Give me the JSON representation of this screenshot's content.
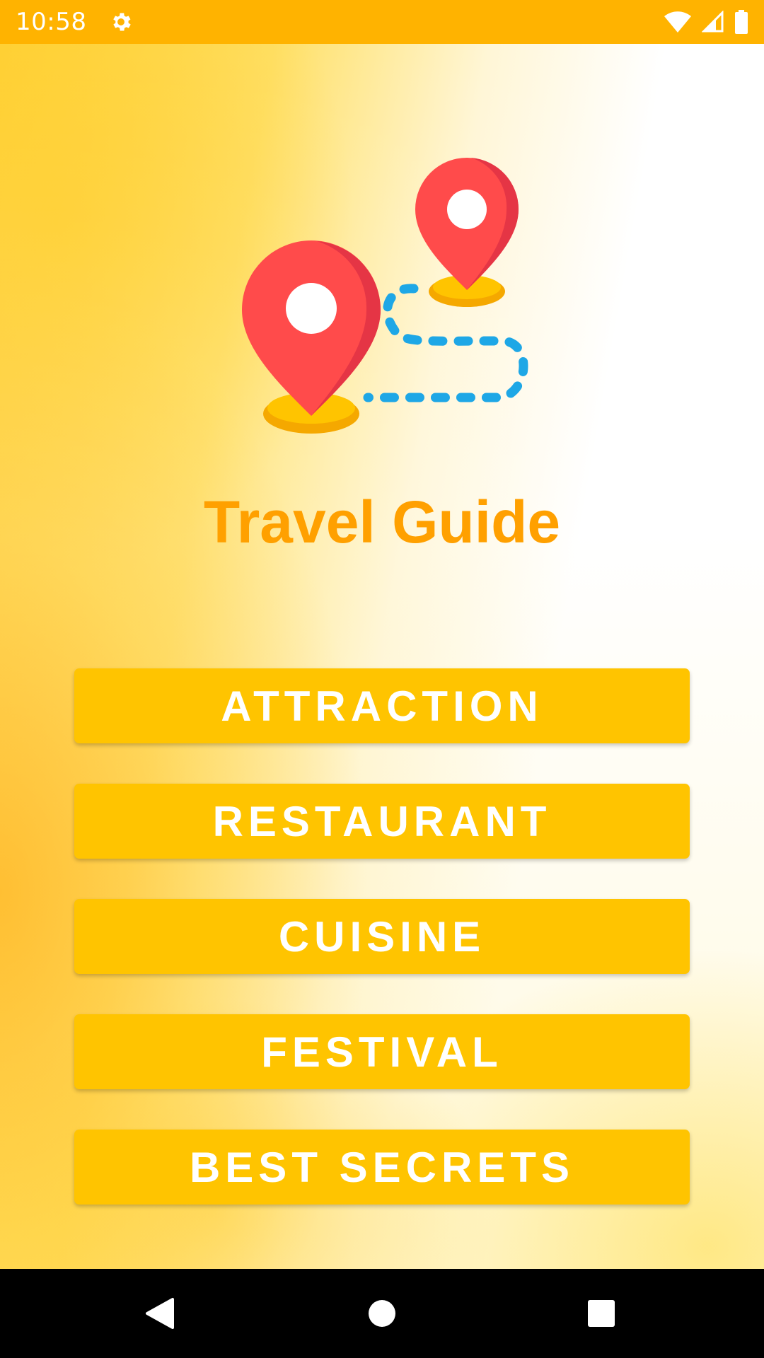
{
  "status_bar": {
    "time": "10:58",
    "icons": [
      "gear-icon",
      "wifi-icon",
      "signal-icon",
      "battery-icon"
    ]
  },
  "app": {
    "title": "Travel Guide",
    "logo_icon": "map-route-pins-icon"
  },
  "menu": {
    "items": [
      {
        "label": "ATTRACTION"
      },
      {
        "label": "RESTAURANT"
      },
      {
        "label": "CUISINE"
      },
      {
        "label": "FESTIVAL"
      },
      {
        "label": "BEST SECRETS"
      }
    ]
  },
  "nav_bar": {
    "icons": [
      "back-icon",
      "home-icon",
      "recents-icon"
    ]
  },
  "colors": {
    "status_bar": "#FFB300",
    "title": "#FFA000",
    "button": "#FFC400",
    "button_text": "#FFFFFF",
    "pin": "#FF4B4B",
    "route": "#1EA7E6",
    "pin_base": "#FFC400"
  }
}
